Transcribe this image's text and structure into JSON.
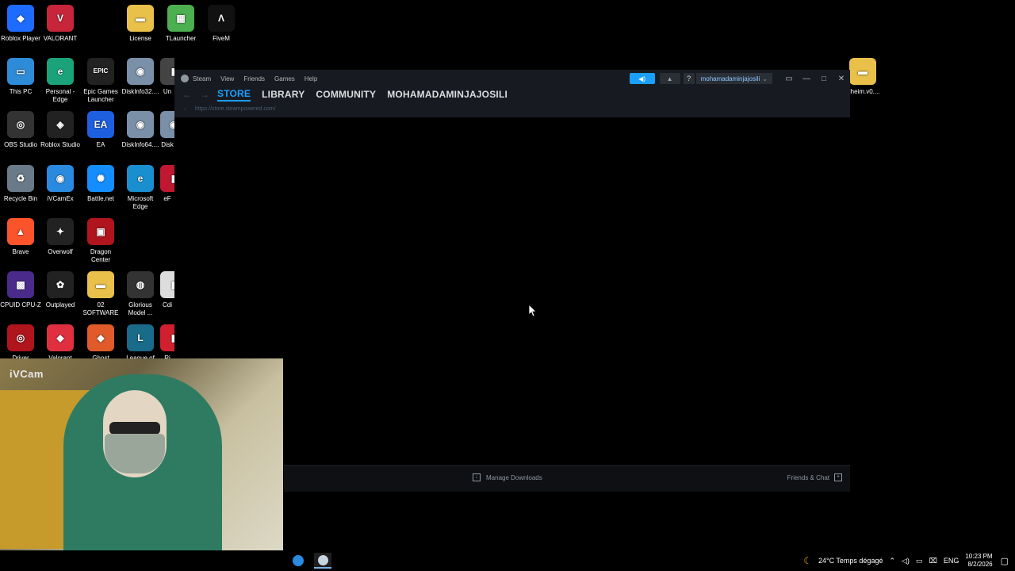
{
  "desktop_icons": [
    {
      "label": "Roblox Player",
      "color": "#1e6cff",
      "glyph": "◆"
    },
    {
      "label": "VALORANT",
      "color": "#c6253a",
      "glyph": "V"
    },
    {
      "label": "License",
      "color": "#e8c04a",
      "glyph": "▬"
    },
    {
      "label": "TLauncher",
      "color": "#4caf50",
      "glyph": "▦"
    },
    {
      "label": "FiveM",
      "color": "#111111",
      "glyph": "Λ"
    },
    {
      "label": "This PC",
      "color": "#2e8bd8",
      "glyph": "▭"
    },
    {
      "label": "Personal - Edge",
      "color": "#1aa37a",
      "glyph": "e"
    },
    {
      "label": "Epic Games Launcher",
      "color": "#222222",
      "glyph": "EPIC"
    },
    {
      "label": "DiskInfo32....",
      "color": "#7a8fa8",
      "glyph": "◉"
    },
    {
      "label": "OBS Studio",
      "color": "#333333",
      "glyph": "◎"
    },
    {
      "label": "Roblox Studio",
      "color": "#222222",
      "glyph": "◈"
    },
    {
      "label": "EA",
      "color": "#1e5fe0",
      "glyph": "EA"
    },
    {
      "label": "DiskInfo64....",
      "color": "#7a8fa8",
      "glyph": "◉"
    },
    {
      "label": "Recycle Bin",
      "color": "#6a7a88",
      "glyph": "♻"
    },
    {
      "label": "iVCamEx",
      "color": "#2a8ae0",
      "glyph": "◉"
    },
    {
      "label": "Battle.net",
      "color": "#148eff",
      "glyph": "✺"
    },
    {
      "label": "Microsoft Edge",
      "color": "#1a8fd0",
      "glyph": "e"
    },
    {
      "label": "Brave",
      "color": "#fb542b",
      "glyph": "▲"
    },
    {
      "label": "Overwolf",
      "color": "#222222",
      "glyph": "✦"
    },
    {
      "label": "Dragon Center",
      "color": "#b0141c",
      "glyph": "▣"
    },
    {
      "label": "CPUID CPU-Z",
      "color": "#4a2a8a",
      "glyph": "▩"
    },
    {
      "label": "Outplayed",
      "color": "#222222",
      "glyph": "✿"
    },
    {
      "label": "02 SOFTWARE",
      "color": "#e8c04a",
      "glyph": "▬"
    },
    {
      "label": "Glorious Model ...",
      "color": "#333333",
      "glyph": "◍"
    },
    {
      "label": "Driver",
      "color": "#b0141c",
      "glyph": "◎"
    },
    {
      "label": "Valorant",
      "color": "#e03040",
      "glyph": "◆"
    },
    {
      "label": "Ghost",
      "color": "#e05a2a",
      "glyph": "◆"
    },
    {
      "label": "League of",
      "color": "#1a6a8a",
      "glyph": "L"
    },
    {
      "label": "Un",
      "color": "#444444",
      "glyph": "▮"
    },
    {
      "label": "Disk",
      "color": "#7a8fa8",
      "glyph": "◉"
    },
    {
      "label": "eF",
      "color": "#c01830",
      "glyph": "▮"
    },
    {
      "label": "Cdi",
      "color": "#dddddd",
      "glyph": "▮"
    },
    {
      "label": "Ri",
      "color": "#d02030",
      "glyph": "▮"
    },
    {
      "label": "alheim.v0....",
      "color": "#e8c04a",
      "glyph": "▬"
    }
  ],
  "steam": {
    "menu": [
      "Steam",
      "View",
      "Friends",
      "Games",
      "Help"
    ],
    "tabs": [
      "STORE",
      "LIBRARY",
      "COMMUNITY",
      "MOHAMADAMINJAJOSILI"
    ],
    "url": "https://store.steampowered.com/",
    "account": "mohamadaminjajosili",
    "help": "?",
    "manage_downloads": "Manage Downloads",
    "friends_chat": "Friends & Chat"
  },
  "webcam": {
    "brand": "iVCam"
  },
  "taskbar": {
    "weather": "24°C  Temps dégagé",
    "lang": "ENG",
    "time": "10:23 PM",
    "date": "8/2/2026"
  }
}
